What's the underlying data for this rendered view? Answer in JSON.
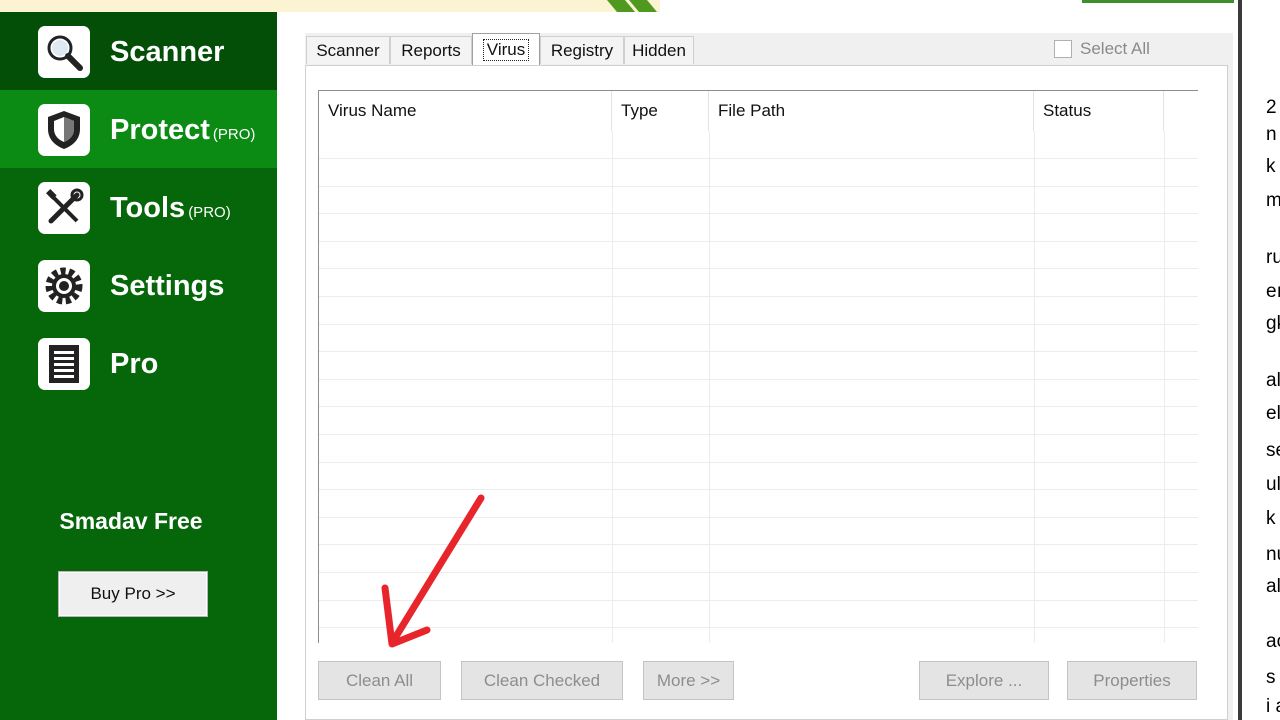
{
  "sidebar": {
    "items": [
      {
        "label": "Scanner",
        "tag": ""
      },
      {
        "label": "Protect",
        "tag": "(PRO)"
      },
      {
        "label": "Tools",
        "tag": "(PRO)"
      },
      {
        "label": "Settings",
        "tag": ""
      },
      {
        "label": "Pro",
        "tag": ""
      }
    ],
    "brand": "Smadav Free",
    "buy_button": "Buy Pro >>"
  },
  "tabs": [
    "Scanner",
    "Reports",
    "Virus",
    "Registry",
    "Hidden"
  ],
  "active_tab": "Virus",
  "select_all_label": "Select All",
  "list": {
    "columns": [
      "Virus Name",
      "Type",
      "File Path",
      "Status"
    ],
    "rows": []
  },
  "buttons": {
    "clean_all": "Clean All",
    "clean_checked": "Clean Checked",
    "more": "More >>",
    "explore": "Explore ...",
    "properties": "Properties"
  },
  "background_text_fragments": [
    "2",
    "n",
    "k",
    "m",
    "ru",
    "eı",
    "gk",
    "al",
    "ela",
    "se",
    "ul",
    "k",
    "nu",
    "al",
    "ac",
    "s",
    "i a"
  ],
  "colors": {
    "sidebar_bg": "#05660a",
    "sidebar_active": "#0b8a14",
    "sidebar_dark": "#044f08",
    "annotation_arrow": "#e8252a"
  }
}
